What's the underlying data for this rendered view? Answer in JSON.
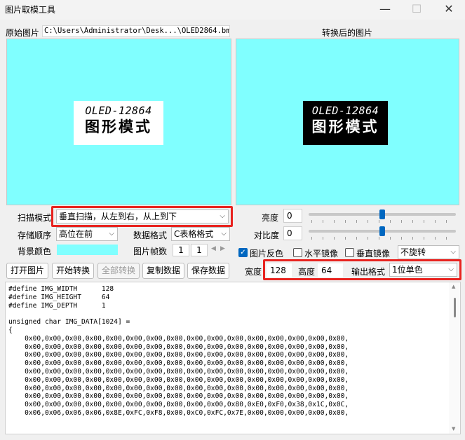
{
  "window": {
    "title": "图片取模工具",
    "min": "—",
    "max": "☐",
    "close": "✕"
  },
  "original": {
    "label": "原始图片",
    "path": "C:\\Users\\Administrator\\Desk...\\OLED2864.bmp"
  },
  "converted": {
    "label": "转换后的图片"
  },
  "image_text": {
    "line1": "OLED-12864",
    "line2": "图形模式"
  },
  "scan": {
    "label": "扫描模式",
    "value": "垂直扫描，从左到右，从上到下"
  },
  "storage": {
    "label": "存储顺序",
    "value": "高位在前"
  },
  "data_format": {
    "label": "数据格式",
    "value": "C表格格式"
  },
  "bg_color": {
    "label": "背景颜色",
    "color": "#80ffff"
  },
  "frames": {
    "label": "图片帧数",
    "current": "1",
    "total": "1"
  },
  "brightness": {
    "label": "亮度",
    "value": "0",
    "level": 0.5
  },
  "contrast": {
    "label": "对比度",
    "value": "0",
    "level": 0.5
  },
  "options": {
    "invert": {
      "label": "图片反色",
      "checked": true
    },
    "hmirror": {
      "label": "水平镜像",
      "checked": false
    },
    "vmirror": {
      "label": "垂直镜像",
      "checked": false
    },
    "rotate": "不旋转"
  },
  "size": {
    "width_label": "宽度",
    "width": "128",
    "height_label": "高度",
    "height": "64"
  },
  "output": {
    "label": "输出格式",
    "value": "1位单色"
  },
  "buttons": {
    "open": "打开图片",
    "start": "开始转换",
    "all": "全部转换",
    "copy": "复制数据",
    "save": "保存数据"
  },
  "code": "#define IMG_WIDTH      128\n#define IMG_HEIGHT     64\n#define IMG_DEPTH      1\n\nunsigned char IMG_DATA[1024] =\n{\n    0x00,0x00,0x00,0x00,0x00,0x00,0x00,0x00,0x00,0x00,0x00,0x00,0x00,0x00,0x00,0x00,\n    0x00,0x00,0x00,0x00,0x00,0x00,0x00,0x00,0x00,0x00,0x00,0x00,0x00,0x00,0x00,0x00,\n    0x00,0x00,0x00,0x00,0x00,0x00,0x00,0x00,0x00,0x00,0x00,0x00,0x00,0x00,0x00,0x00,\n    0x00,0x00,0x00,0x00,0x00,0x00,0x00,0x00,0x00,0x00,0x00,0x00,0x00,0x00,0x00,0x00,\n    0x00,0x00,0x00,0x00,0x00,0x00,0x00,0x00,0x00,0x00,0x00,0x00,0x00,0x00,0x00,0x00,\n    0x00,0x00,0x00,0x00,0x00,0x00,0x00,0x00,0x00,0x00,0x00,0x00,0x00,0x00,0x00,0x00,\n    0x00,0x00,0x00,0x00,0x00,0x00,0x00,0x00,0x00,0x00,0x00,0x00,0x00,0x00,0x00,0x00,\n    0x00,0x00,0x00,0x00,0x00,0x00,0x00,0x00,0x00,0x00,0x00,0x00,0x00,0x00,0x00,0x00,\n    0x00,0x00,0x00,0x00,0x00,0x00,0x00,0x00,0x00,0x00,0x80,0xE0,0xF0,0x38,0x1C,0x0C,\n    0x06,0x06,0x06,0x06,0x8E,0xFC,0xF8,0x00,0xC0,0xFC,0x7E,0x00,0x00,0x00,0x00,0x00,"
}
